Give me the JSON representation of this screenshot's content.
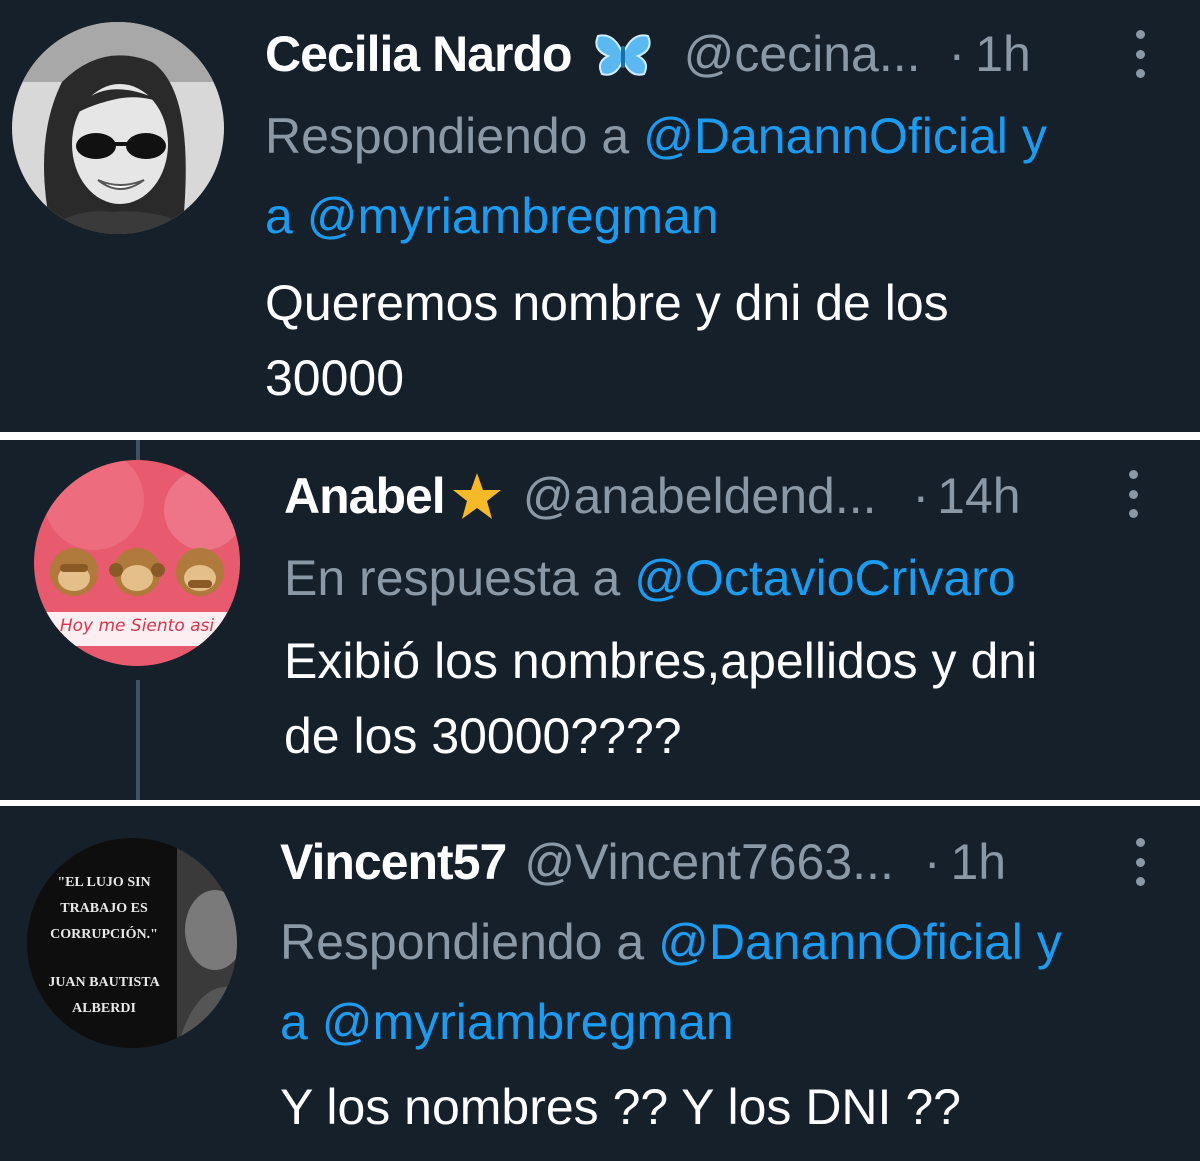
{
  "tweets": [
    {
      "name": "Cecilia Nardo",
      "badge": "butterfly",
      "handle": "@cecina...",
      "separator": "·",
      "time": "1h",
      "reply_prefix": "Respondiendo a",
      "mention1": "@DanannOficial",
      "reply_joiner": "y",
      "reply_joiner2": "a",
      "mention2": "@myriambregman",
      "text_line1": "Queremos nombre y dni de los",
      "text_line2": "30000"
    },
    {
      "name": "Anabel",
      "badge": "star",
      "handle": "@anabeldend...",
      "separator": "·",
      "time": "14h",
      "reply_prefix": "En respuesta a",
      "mention1": "@OctavioCrivaro",
      "text_line1": "Exibió los nombres,apellidos y dni",
      "text_line2": "de los 30000????",
      "avatar_caption": "Hoy me Siento asi"
    },
    {
      "name": "Vincent57",
      "handle": "@Vincent7663...",
      "separator": "·",
      "time": "1h",
      "reply_prefix": "Respondiendo a",
      "mention1": "@DanannOficial",
      "reply_joiner": "y",
      "reply_joiner2": "a",
      "mention2": "@myriambregman",
      "text_line1": "Y los nombres ?? Y los DNI ??",
      "avatar_quote": [
        "\"EL LUJO SIN",
        "TRABAJO ES",
        "CORRUPCIÓN.\"",
        "JUAN BAUTISTA",
        "ALBERDI"
      ]
    }
  ],
  "colors": {
    "background": "#15202b",
    "text": "#ffffff",
    "secondary": "#8b98a5",
    "link": "#1d9bf0",
    "divider": "#ffffff"
  },
  "icons": [
    "butterfly-icon",
    "star-icon",
    "more-options-icon"
  ]
}
